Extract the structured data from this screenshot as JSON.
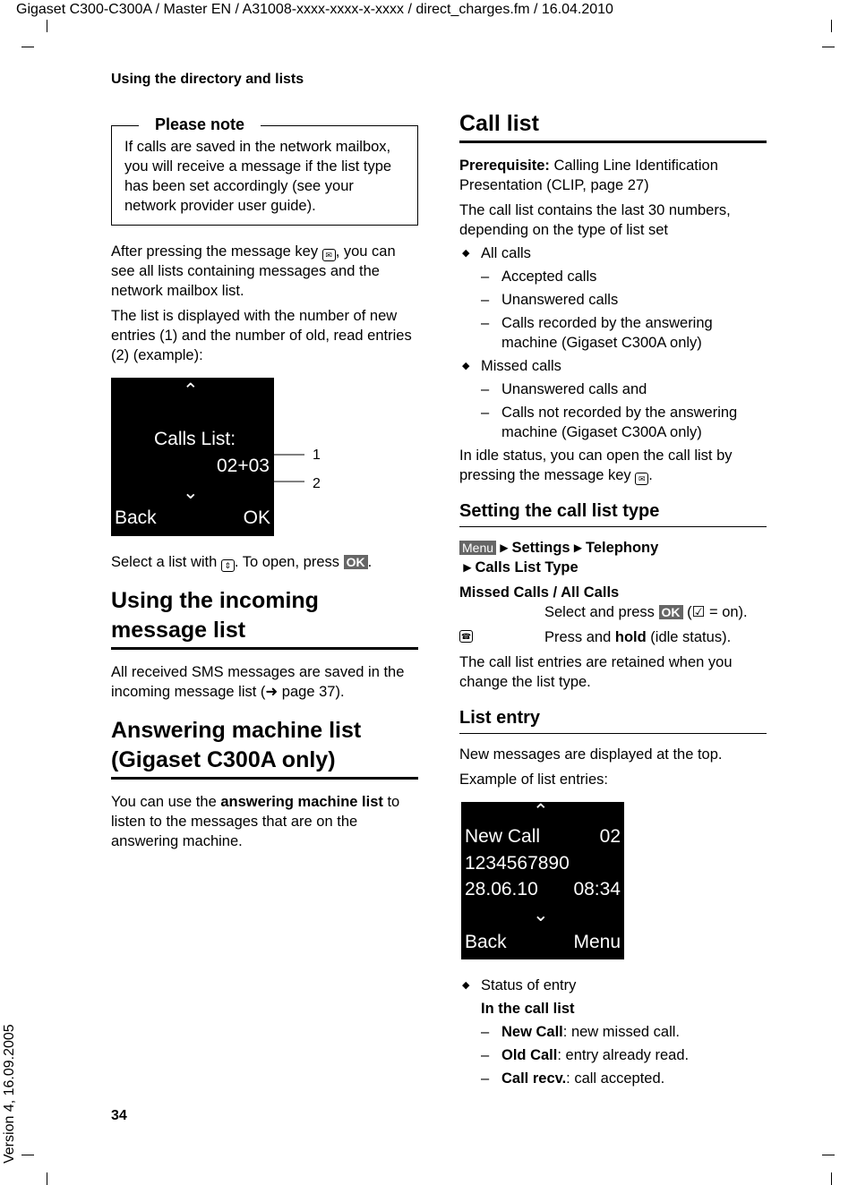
{
  "header": {
    "title": "Gigaset C300-C300A / Master EN / A31008-xxxx-xxxx-x-xxxx / direct_charges.fm / 16.04.2010",
    "section": "Using the directory and lists",
    "page_number": "34",
    "version": "Version 4, 16.09.2005"
  },
  "left": {
    "note_label": "Please note",
    "note_text": "If calls are saved in the network mailbox, you will receive a message if the list type has been set accordingly (see your network provider user guide).",
    "p1a": "After pressing the message key ",
    "p1b": ", you can see all lists containing messages and the network mailbox list.",
    "p2": "The list is displayed with the number of new entries (1) and the number of old, read entries (2) (example):",
    "display": {
      "title": "Calls List:",
      "count": "02+03",
      "left": "Back",
      "right": "OK",
      "callout1": "1",
      "callout2": "2"
    },
    "p3a": "Select a list with ",
    "p3b": ". To open, press ",
    "ok": "OK",
    "p3c": ".",
    "h_incoming": "Using the incoming message list",
    "p4": "All received SMS messages are saved in the incoming message list (➜ page 37).",
    "h_am": "Answering machine list (Gigaset C300A only)",
    "p5a": "You can use the ",
    "p5b": "answering machine list",
    "p5c": " to listen to the messages that are on the answering machine."
  },
  "right": {
    "h_calllist": "Call list",
    "prereq_label": "Prerequisite:",
    "prereq": " Calling Line Identification Presentation (CLIP, page 27)",
    "p1": "The call list contains the last 30 numbers, depending on the type of list set",
    "all_calls": "All calls",
    "all_sub": [
      "Accepted calls",
      "Unanswered calls",
      "Calls recorded by the answering machine (Gigaset C300A only)"
    ],
    "missed": "Missed calls",
    "missed_sub": [
      "Unanswered calls and",
      "Calls not recorded by the answering machine (Gigaset C300A only)"
    ],
    "p2": "In idle status, you can open the call list by pressing the message key ",
    "h_type": "Setting the call list type",
    "menu": "Menu",
    "path": [
      "Settings",
      "Telephony",
      "Calls List Type"
    ],
    "options": "Missed Calls / All Calls",
    "select_a": "Select and press ",
    "ok": "OK",
    "select_b": " (",
    "select_c": " = on).",
    "hold_a": "Press and ",
    "hold_b": "hold",
    "hold_c": " (idle status).",
    "p3": "The call list entries are retained when you change the list type.",
    "h_entry": "List entry",
    "p4": "New messages are displayed at the top.",
    "p5": "Example of list entries:",
    "display": {
      "l1a": "New Call",
      "l1b": "02",
      "l2": "1234567890",
      "l3a": "28.06.10",
      "l3b": "08:34",
      "left": "Back",
      "right": "Menu"
    },
    "status": "Status of entry",
    "in_list": "In the call list",
    "entries": [
      {
        "k": "New Call",
        "v": ": new missed call."
      },
      {
        "k": "Old Call",
        "v": ": entry already read."
      },
      {
        "k": "Call recv.",
        "v": ": call accepted."
      }
    ]
  }
}
